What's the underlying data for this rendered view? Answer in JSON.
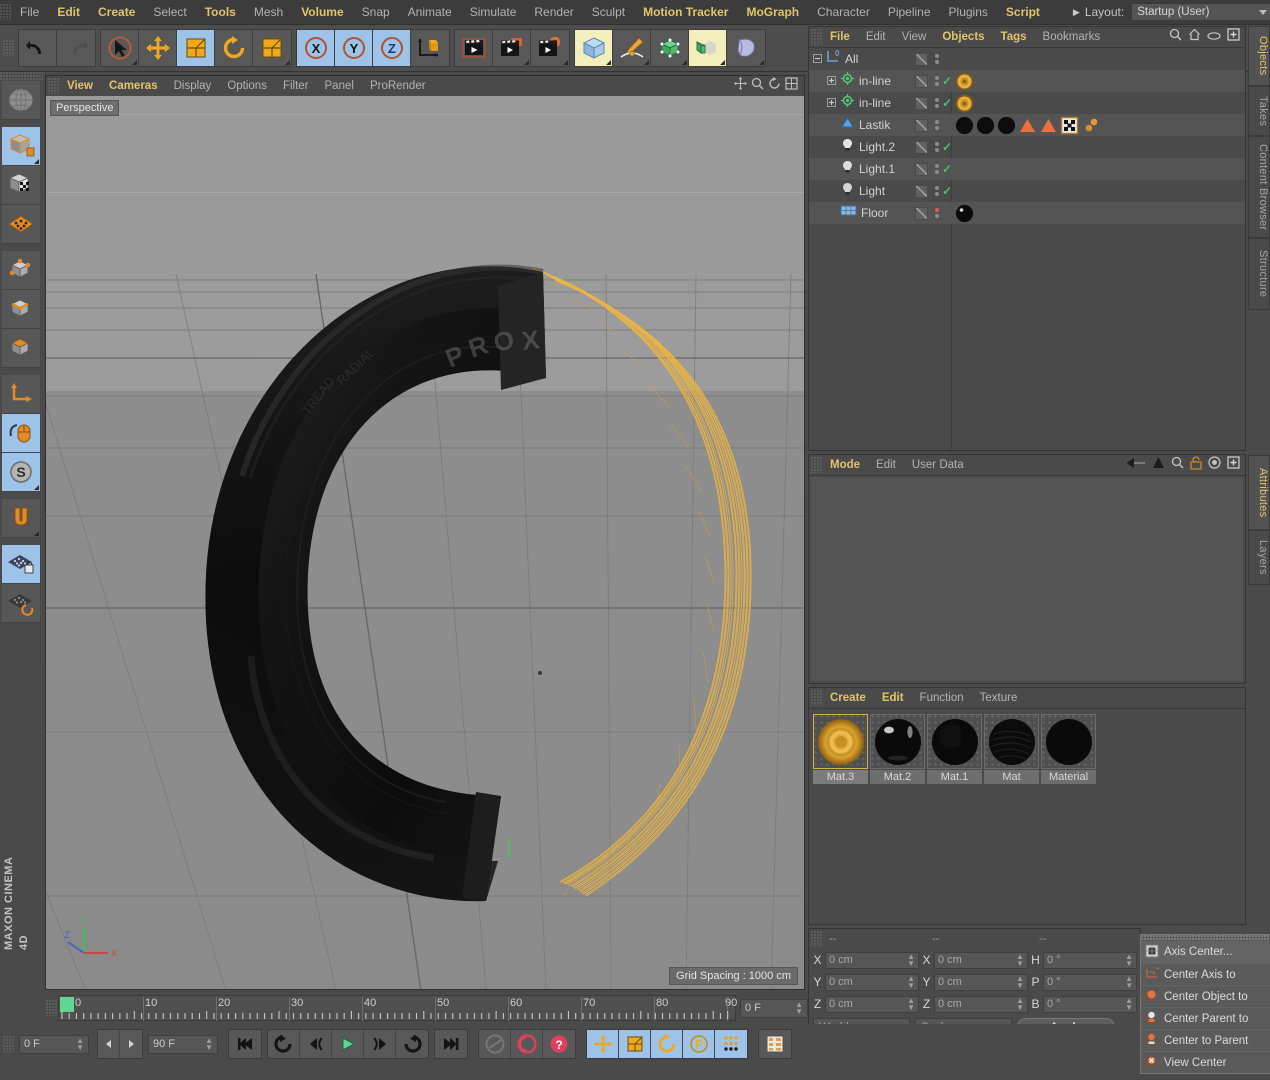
{
  "app": {
    "name": "MAXON CINEMA 4D",
    "logo_line1": "MAXON",
    "logo_line2": "CINEMA 4D"
  },
  "menubar": {
    "items": [
      {
        "label": "File",
        "highlight": false
      },
      {
        "label": "Edit",
        "highlight": true
      },
      {
        "label": "Create",
        "highlight": true
      },
      {
        "label": "Select",
        "highlight": false
      },
      {
        "label": "Tools",
        "highlight": true
      },
      {
        "label": "Mesh",
        "highlight": false
      },
      {
        "label": "Volume",
        "highlight": true
      },
      {
        "label": "Snap",
        "highlight": false
      },
      {
        "label": "Animate",
        "highlight": false
      },
      {
        "label": "Simulate",
        "highlight": false
      },
      {
        "label": "Render",
        "highlight": false
      },
      {
        "label": "Sculpt",
        "highlight": false
      },
      {
        "label": "Motion Tracker",
        "highlight": true
      },
      {
        "label": "MoGraph",
        "highlight": true
      },
      {
        "label": "Character",
        "highlight": false
      },
      {
        "label": "Pipeline",
        "highlight": false
      },
      {
        "label": "Plugins",
        "highlight": false
      },
      {
        "label": "Script",
        "highlight": true
      }
    ],
    "layout_label": "Layout:",
    "layout_value": "Startup (User)",
    "search_icon": "search-icon"
  },
  "viewport": {
    "menu": [
      {
        "label": "View",
        "highlight": true
      },
      {
        "label": "Cameras",
        "highlight": true
      },
      {
        "label": "Display",
        "highlight": false
      },
      {
        "label": "Options",
        "highlight": false
      },
      {
        "label": "Filter",
        "highlight": false
      },
      {
        "label": "Panel",
        "highlight": false
      },
      {
        "label": "ProRender",
        "highlight": false
      }
    ],
    "camera_label": "Perspective",
    "grid_spacing": "Grid Spacing : 1000 cm",
    "axis_x": "X",
    "axis_y": "Y",
    "axis_z": "Z",
    "colors": {
      "tire": "#121212",
      "rim_wire": "#e8b040",
      "sky": "#9a9a9a",
      "floor": "#8d8d8d"
    }
  },
  "object_manager": {
    "title": "Objects",
    "menu": [
      {
        "label": "File",
        "highlight": true
      },
      {
        "label": "Edit",
        "highlight": false
      },
      {
        "label": "View",
        "highlight": false
      },
      {
        "label": "Objects",
        "highlight": true
      },
      {
        "label": "Tags",
        "highlight": true
      },
      {
        "label": "Bookmarks",
        "highlight": false
      }
    ],
    "icons": [
      "search-icon",
      "home-icon",
      "eye-icon",
      "expand-icon"
    ],
    "rows": [
      {
        "label": "All",
        "icon": "layer-icon",
        "indent": 0,
        "expander": "minus",
        "check": false,
        "dot": "normal",
        "tags": []
      },
      {
        "label": "in-line",
        "icon": "spline-icon",
        "indent": 1,
        "expander": "plus",
        "check": true,
        "dot": "normal",
        "tags": [
          "gold-material"
        ]
      },
      {
        "label": "in-line",
        "icon": "spline-icon",
        "indent": 1,
        "expander": "plus",
        "check": true,
        "dot": "normal",
        "tags": [
          "gold-material"
        ]
      },
      {
        "label": "Lastik",
        "icon": "polygon-icon",
        "indent": 1,
        "expander": "none",
        "check": false,
        "dot": "normal",
        "tags": [
          "black-material",
          "black-material",
          "black-material",
          "orange-triangle",
          "orange-triangle",
          "checker-tag",
          "particle-tag"
        ]
      },
      {
        "label": "Light.2",
        "icon": "light-icon",
        "indent": 1,
        "expander": "none",
        "check": true,
        "dot": "normal",
        "tags": []
      },
      {
        "label": "Light.1",
        "icon": "light-icon",
        "indent": 1,
        "expander": "none",
        "check": true,
        "dot": "normal",
        "tags": []
      },
      {
        "label": "Light",
        "icon": "light-icon",
        "indent": 1,
        "expander": "none",
        "check": true,
        "dot": "normal",
        "tags": []
      },
      {
        "label": "Floor",
        "icon": "floor-icon",
        "indent": 1,
        "expander": "none",
        "check": false,
        "dot": "red",
        "tags": [
          "black-material"
        ]
      }
    ]
  },
  "attribute_manager": {
    "title": "Attributes",
    "menu": [
      {
        "label": "Mode",
        "highlight": true
      },
      {
        "label": "Edit",
        "highlight": false
      },
      {
        "label": "User Data",
        "highlight": false
      }
    ],
    "icons": [
      "back-arrow-icon",
      "up-arrow-icon",
      "search-icon",
      "lock-icon",
      "target-icon",
      "expand-icon"
    ]
  },
  "material_manager": {
    "menu": [
      {
        "label": "Create",
        "highlight": true
      },
      {
        "label": "Edit",
        "highlight": true
      },
      {
        "label": "Function",
        "highlight": false
      },
      {
        "label": "Texture",
        "highlight": false
      }
    ],
    "materials": [
      {
        "name": "Mat.3",
        "type": "gold",
        "selected": true
      },
      {
        "name": "Mat.2",
        "type": "glossy-black",
        "selected": false
      },
      {
        "name": "Mat.1",
        "type": "matte-black",
        "selected": false
      },
      {
        "name": "Mat",
        "type": "brushed-black",
        "selected": false
      },
      {
        "name": "Material",
        "type": "flat-black",
        "selected": false
      }
    ]
  },
  "coordinates": {
    "header": [
      "--",
      "--",
      "--"
    ],
    "position": {
      "label_x": "X",
      "label_y": "Y",
      "label_z": "Z",
      "x": "0 cm",
      "y": "0 cm",
      "z": "0 cm"
    },
    "size": {
      "label_x": "X",
      "label_y": "Y",
      "label_z": "Z",
      "x": "0 cm",
      "y": "0 cm",
      "z": "0 cm"
    },
    "rotation": {
      "label_h": "H",
      "label_p": "P",
      "label_b": "B",
      "h": "0 °",
      "p": "0 °",
      "b": "0 °"
    },
    "space_select": "World",
    "mode_select": "Scale",
    "apply_button": "Apply"
  },
  "context_menu": {
    "items": [
      {
        "label": "Axis Center...",
        "icon": "axis-center-icon",
        "highlighted": true
      },
      {
        "label": "Center Axis to",
        "icon": "center-axis-icon",
        "highlighted": false
      },
      {
        "label": "Center Object to",
        "icon": "center-object-icon",
        "highlighted": false
      },
      {
        "label": "Center Parent to",
        "icon": "center-parent-icon",
        "highlighted": false
      },
      {
        "label": "Center to Parent",
        "icon": "center-to-parent-icon",
        "highlighted": false
      },
      {
        "label": "View Center",
        "icon": "view-center-icon",
        "highlighted": false
      }
    ]
  },
  "side_tabs": [
    {
      "label": "Objects",
      "active": true
    },
    {
      "label": "Takes",
      "active": false
    },
    {
      "label": "Content Browser",
      "active": false
    },
    {
      "label": "Structure",
      "active": false
    },
    {
      "label": "Attributes",
      "active": true
    },
    {
      "label": "Layers",
      "active": false
    }
  ],
  "timeline": {
    "start_frame": "0 F",
    "end_frame": "90 F",
    "current_frame": "0 F",
    "ticks": [
      "0",
      "10",
      "20",
      "30",
      "40",
      "50",
      "60",
      "70",
      "80",
      "90"
    ],
    "range_min": 0,
    "range_max": 90,
    "playhead": 0
  },
  "top_toolbar": {
    "groups": [
      {
        "buttons": [
          {
            "icon": "undo-icon",
            "state": "normal"
          },
          {
            "icon": "redo-icon",
            "state": "disabled"
          }
        ]
      },
      {
        "buttons": [
          {
            "icon": "live-selection-icon",
            "state": "normal",
            "corner": true
          },
          {
            "icon": "move-icon",
            "state": "normal"
          },
          {
            "icon": "scale-icon",
            "state": "selected"
          },
          {
            "icon": "rotate-icon",
            "state": "normal"
          },
          {
            "icon": "transform-icon",
            "state": "normal",
            "corner": true
          }
        ]
      },
      {
        "buttons": [
          {
            "icon": "axis-x-icon",
            "state": "selected"
          },
          {
            "icon": "axis-y-icon",
            "state": "selected"
          },
          {
            "icon": "axis-z-icon",
            "state": "selected"
          },
          {
            "icon": "world-object-axis-icon",
            "state": "normal"
          }
        ]
      },
      {
        "buttons": [
          {
            "icon": "render-view-icon",
            "state": "normal"
          },
          {
            "icon": "render-to-picture-icon",
            "state": "normal",
            "corner": true
          },
          {
            "icon": "render-settings-icon",
            "state": "normal",
            "corner": true
          }
        ]
      },
      {
        "buttons": [
          {
            "icon": "cube-primitive-icon",
            "state": "light",
            "corner": true
          },
          {
            "icon": "spline-pen-icon",
            "state": "normal",
            "corner": true
          },
          {
            "icon": "generator-icon",
            "state": "normal",
            "corner": true
          },
          {
            "icon": "array-icon",
            "state": "light",
            "corner": true
          },
          {
            "icon": "deformer-icon",
            "state": "normal",
            "corner": true
          }
        ]
      }
    ]
  },
  "left_toolbar": {
    "buttons": [
      {
        "icon": "axis-globe-icon",
        "state": "normal"
      },
      {
        "icon": "make-editable-icon",
        "state": "selected",
        "corner": true
      },
      {
        "icon": "texture-axis-icon",
        "state": "normal"
      },
      {
        "icon": "viewport-solo-icon",
        "state": "normal"
      },
      {
        "icon": "point-mode-icon",
        "state": "normal"
      },
      {
        "icon": "edge-mode-icon",
        "state": "normal"
      },
      {
        "icon": "polygon-mode-icon",
        "state": "normal"
      },
      {
        "icon": "world-coordinates-icon",
        "state": "normal"
      },
      {
        "icon": "mouse-move-icon",
        "state": "selected"
      },
      {
        "icon": "soft-selection-icon",
        "state": "selected",
        "corner": true
      },
      {
        "icon": "snap-magnet-icon",
        "state": "normal",
        "corner": true
      },
      {
        "icon": "workplane-lock-icon",
        "state": "selected"
      },
      {
        "icon": "workplane-rotate-icon",
        "state": "normal"
      }
    ]
  },
  "bottom_toolbar": {
    "groups": [
      {
        "buttons": [
          {
            "icon": "goto-start-icon"
          }
        ]
      },
      {
        "buttons": [
          {
            "icon": "play-backwards-loop-icon"
          },
          {
            "icon": "step-back-icon"
          },
          {
            "icon": "play-icon"
          },
          {
            "icon": "step-forward-icon"
          },
          {
            "icon": "play-loop-icon"
          }
        ]
      },
      {
        "buttons": [
          {
            "icon": "goto-end-icon"
          }
        ]
      },
      {
        "buttons": [
          {
            "icon": "record-disabled-icon"
          },
          {
            "icon": "autokey-icon"
          },
          {
            "icon": "key-help-icon"
          }
        ]
      },
      {
        "buttons": [
          {
            "icon": "record-position-icon",
            "state": "selected"
          },
          {
            "icon": "record-scale-icon",
            "state": "selected"
          },
          {
            "icon": "record-rotation-icon",
            "state": "selected"
          },
          {
            "icon": "record-parameter-icon",
            "state": "selected"
          },
          {
            "icon": "record-pla-icon",
            "state": "selected"
          }
        ]
      },
      {
        "buttons": [
          {
            "icon": "timeline-view-icon"
          }
        ]
      }
    ]
  }
}
